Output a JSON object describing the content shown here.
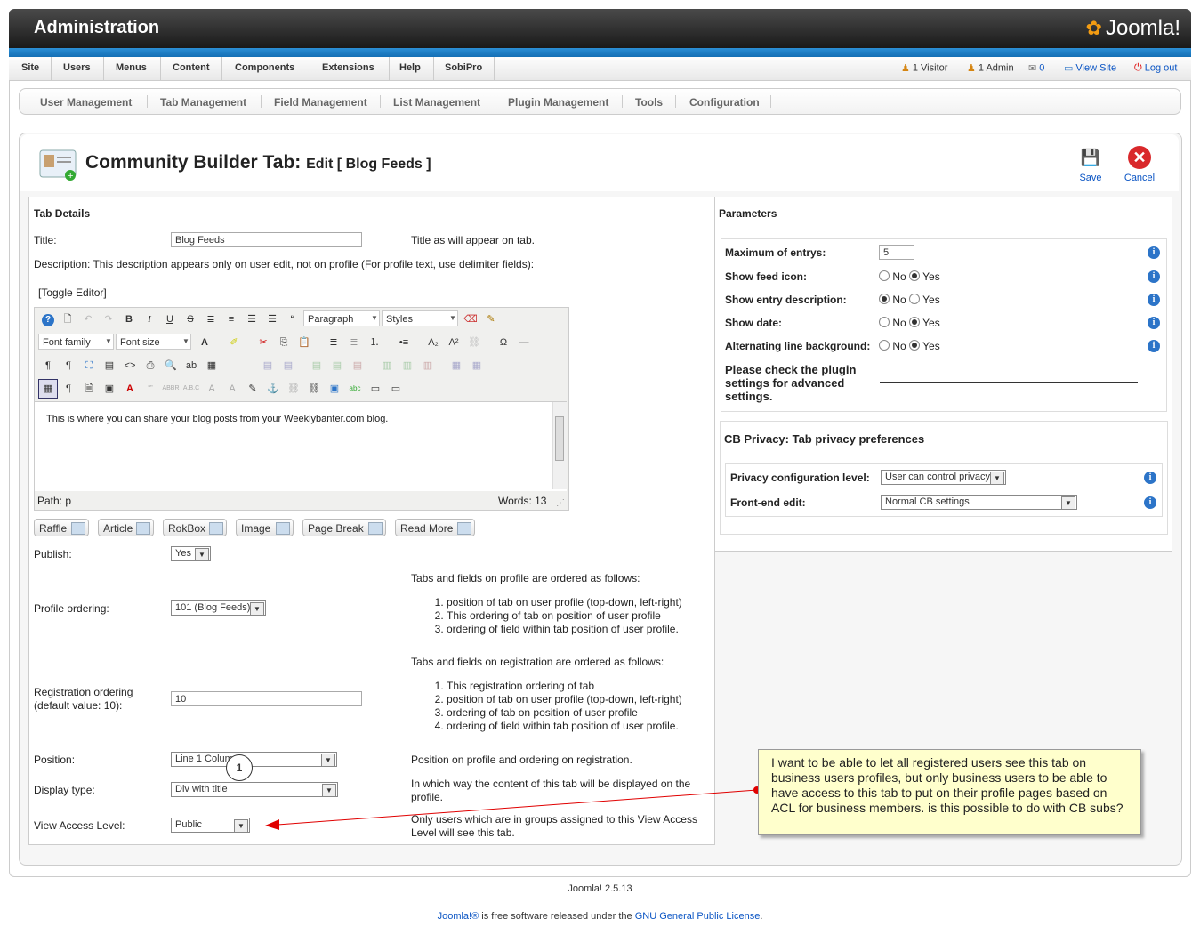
{
  "header": {
    "title": "Administration",
    "logo_text": "Joomla!"
  },
  "menu": {
    "items": [
      "Site",
      "Users",
      "Menus",
      "Content",
      "Components",
      "Extensions",
      "Help",
      "SobiPro"
    ]
  },
  "status": {
    "visitors": "1 Visitor",
    "admins": "1 Admin",
    "messages": "0",
    "view_site": "View Site",
    "logout": "Log out"
  },
  "submenu": {
    "items": [
      "User Management",
      "Tab Management",
      "Field Management",
      "List Management",
      "Plugin Management",
      "Tools",
      "Configuration"
    ]
  },
  "page": {
    "title": "Community Builder Tab:",
    "subtitle": "Edit [ Blog Feeds ]"
  },
  "toolbar": {
    "save": "Save",
    "cancel": "Cancel"
  },
  "tab_details": {
    "heading": "Tab Details",
    "title_label": "Title:",
    "title_value": "Blog Feeds",
    "title_help": "Title as will appear on tab.",
    "description_label": "Description: This description appears only on user edit, not on profile (For profile text, use delimiter fields):",
    "toggle_editor": "[Toggle Editor]"
  },
  "editor": {
    "format": "Paragraph",
    "styles": "Styles",
    "font_family": "Font family",
    "font_size": "Font size",
    "content": "This is where you can share your blog posts from your Weeklybanter.com blog.",
    "path": "Path:  p",
    "words": "Words: 13"
  },
  "editor_buttons": [
    "Raffle",
    "Article",
    "RokBox",
    "Image",
    "Page Break",
    "Read More"
  ],
  "form": {
    "publish_label": "Publish:",
    "publish_value": "Yes",
    "profile_ordering_label": "Profile ordering:",
    "profile_ordering_value": "101 (Blog Feeds)",
    "profile_order_heading": "Tabs and fields on profile are ordered as follows:",
    "profile_order_items": [
      "position of tab on user profile (top-down, left-right)",
      "This ordering of tab on position of user profile",
      "ordering of field within tab position of user profile."
    ],
    "reg_ordering_label_1": "Registration ordering",
    "reg_ordering_label_2": "(default value: 10):",
    "reg_ordering_value": "10",
    "reg_order_heading": "Tabs and fields on registration are ordered as follows:",
    "reg_order_items": [
      "This registration ordering of tab",
      "position of tab on user profile (top-down, left-right)",
      "ordering of tab on position of user profile",
      "ordering of field within tab position of user profile."
    ],
    "position_label": "Position:",
    "position_value": "Line 1 Colum",
    "position_help": "Position on profile and ordering on registration.",
    "display_type_label": "Display type:",
    "display_type_value": "Div with title",
    "display_type_help": "In which way the content of this tab will be displayed on the profile.",
    "view_access_label": "View Access Level:",
    "view_access_value": "Public",
    "view_access_help": "Only users which are in groups assigned to this View Access Level will see this tab."
  },
  "parameters": {
    "heading": "Parameters",
    "max_entries_label": "Maximum of entrys:",
    "max_entries_value": "5",
    "show_feed_icon_label": "Show feed icon:",
    "show_entry_desc_label": "Show entry description:",
    "show_date_label": "Show date:",
    "alt_line_bg_label": "Alternating line background:",
    "no": "No",
    "yes": "Yes",
    "plugin_note": "Please check the plugin settings for advanced settings.",
    "info_glyph": "i"
  },
  "privacy": {
    "heading": "CB Privacy: Tab privacy preferences",
    "config_label": "Privacy configuration level:",
    "config_value": "User can control privacy",
    "frontend_label": "Front-end edit:",
    "frontend_value": "Normal CB settings"
  },
  "annotation": {
    "callout_number": "1",
    "note": "I want to be able to let all registered users see this tab on business users profiles, but only business users to be able to have access to this tab to put on their profile pages based on ACL for business members.  is this possible to do with CB subs?",
    "arrow_color": "#e00000"
  },
  "footer": {
    "version": "Joomla! 2.5.13",
    "license_prefix": "Joomla!®",
    "license_mid": " is free software released under the ",
    "license_link": "GNU General Public License",
    "license_end": "."
  }
}
